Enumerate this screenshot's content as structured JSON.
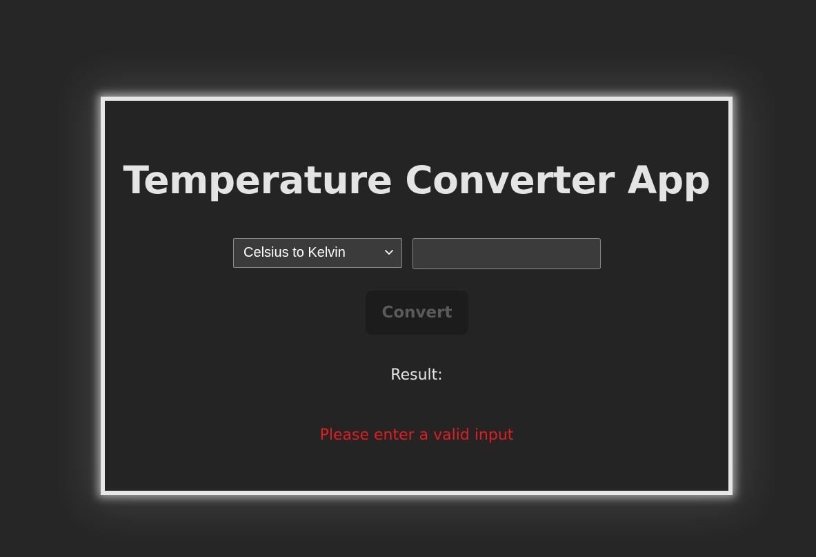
{
  "app": {
    "title": "Temperature Converter App"
  },
  "converter": {
    "mode_selected": "Celsius to Kelvin",
    "input_value": "",
    "convert_label": "Convert",
    "result_label": "Result:",
    "error_message": "Please enter a valid input"
  },
  "colors": {
    "background": "#262626",
    "card": "#242424",
    "card_border": "#e6e6e6",
    "error": "#e51c1c",
    "button_disabled_text": "#5a5a5a"
  }
}
